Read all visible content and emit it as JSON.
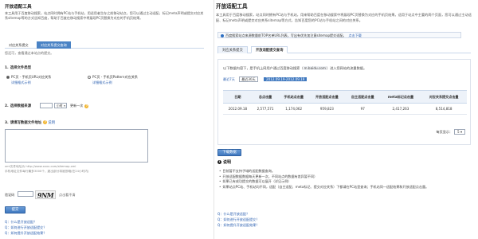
{
  "left": {
    "title": "开放适配工具",
    "description": "本工具用于百度移动搜索，站点同时拥有PC站与手机站，用适用者生存之前移动站点，您可以通过主动适配、标记meta声明或提交对应关系sitemap等的方式告知百度，帮助于百度在移动搜索中将展现PC页替换为对应的手机页结果。",
    "tabs": [
      "对应关系提交",
      "对应关系提交查询"
    ],
    "tip": "您还可，查看通过本站点的提交。",
    "section1": {
      "num": "1.",
      "label": "选择文件类型"
    },
    "options": [
      {
        "label": "PC页 - 手机页URL对应关系",
        "example": "详细格式示例"
      },
      {
        "label": "PC页 - 手机页Pattern对应关系",
        "example": "详细格式示例"
      }
    ],
    "section2": {
      "num": "2.",
      "label": "选择数据来源",
      "interval_label": "更新一次",
      "unit_value": "小时",
      "help": "?"
    },
    "section3": {
      "num": "3.",
      "label": "请填写数据文件地址",
      "help": "?",
      "hint_link": "说明"
    },
    "textarea_hint_1": "xml文件地址为 http://www.xxxx.com/sitemap.xml",
    "textarea_hint_2": "手机地址文件每行最多3000个，超出部分将被忽略(在24小时内)",
    "captcha_label": "验证码",
    "captcha_text": "9NM",
    "captcha_refresh": "点击看不清",
    "submit": "提交",
    "qa": [
      "Q：什么是开放适配？",
      "Q：如何进行开放适配提交？",
      "Q：如何提升开放适配效果？"
    ]
  },
  "right": {
    "title": "开放适配工具",
    "description": "本工具用于百度移动搜索，站点同时拥有PC站与手机站，用来帮助百度在移动搜索中将展现PC页替换为对应的手机页结果。适用于站点中主要的两个页面，您可以通过主动适配、标记meta声明或提交对应关系sitemap等方式，告知百度您的PC站与手机站之间的对应关系。",
    "notice": "百度搜索站点来源数量前TOP名单URL列表，写出有优先加注意sitemap提交适配。",
    "notice_link": "点击下载",
    "tabs": [
      "对应关系提交",
      "开放适配提交查询"
    ],
    "panel_line_prefix": "以下数据内容下，是手机上网用户通过百度移动搜索（",
    "panel_line_code": "m.baidu.com",
    "panel_line_suffix": "）进入您网站的流量数据。",
    "filters": [
      "最近7天",
      "最近30天"
    ],
    "date_range": "2012.09.19-2012.09.19",
    "table": {
      "headers": [
        "日期",
        "总点击量",
        "手机站点击量",
        "开放适配点击量",
        "自主适配点击量",
        "meta标记点击量",
        "对应关系提交点击量"
      ],
      "rows": [
        [
          "2012.09.18",
          "2,577,571",
          "1,174,062",
          "959,823",
          "97",
          "2,417,263",
          "8,514,818"
        ]
      ]
    },
    "pager_label": "每页显示：",
    "pager_value": "5",
    "download_button": "下载数据",
    "notes_title": "说明",
    "notes": [
      "目前暂不支持子域的适配数据查询。",
      "开放适配数据数据每天更新一次，不同站点的数据有差异暂不同）",
      "如果已有成功提交的数据可以展开（详见示例）",
      "如果站点PC站、手机站均不同，适配（自主适配、meta标记、提交对应关系）下都请在PC站里查询；手机站同一适配结果和开放适配点击量。"
    ],
    "qa": [
      "Q：什么是开放适配？",
      "Q：如何进行开放适配提交？",
      "Q：如何提升开放适配效果？"
    ]
  }
}
